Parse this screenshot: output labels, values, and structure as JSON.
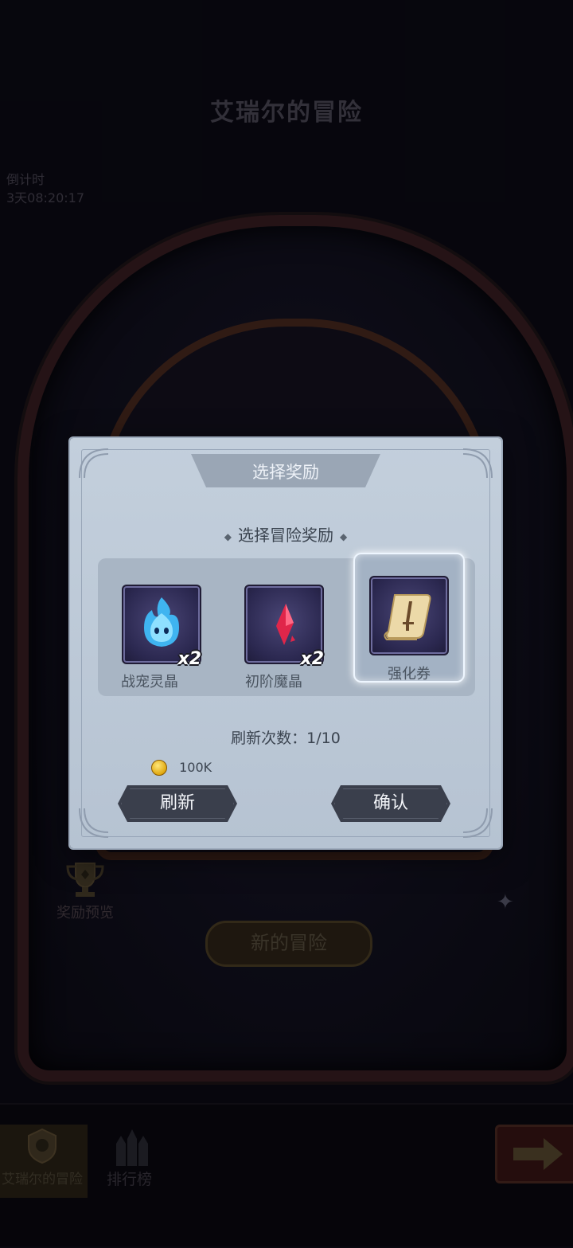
{
  "header": {
    "title": "艾瑞尔的冒险"
  },
  "countdown": {
    "label": "倒计时",
    "value": "3天08:20:17"
  },
  "side": {
    "reward_preview_label": "奖励预览"
  },
  "main": {
    "new_adventure_label": "新的冒险"
  },
  "bottom_nav": {
    "tabs": [
      {
        "label": "艾瑞尔的冒险",
        "active": true
      },
      {
        "label": "排行榜",
        "active": false
      }
    ]
  },
  "dialog": {
    "title": "选择奖励",
    "subtitle": "选择冒险奖励",
    "subtitle_dot": "◆",
    "rewards": [
      {
        "name": "战宠灵晶",
        "count": "x2",
        "icon": "blue-flame-spirit-icon",
        "selected": false
      },
      {
        "name": "初阶魔晶",
        "count": "x2",
        "icon": "red-crystal-icon",
        "selected": false
      },
      {
        "name": "强化券",
        "count": "",
        "icon": "scroll-sword-icon",
        "selected": true
      }
    ],
    "refresh_count_label": "刷新次数：1/10",
    "refresh_cost": "100K",
    "refresh_button_label": "刷新",
    "confirm_button_label": "确认"
  },
  "colors": {
    "dialog_bg": "#bfcbd9",
    "button_bg": "#3a3f4c",
    "panel_bg": "#a8b5c4",
    "selected_glow": "#eef6ff"
  }
}
